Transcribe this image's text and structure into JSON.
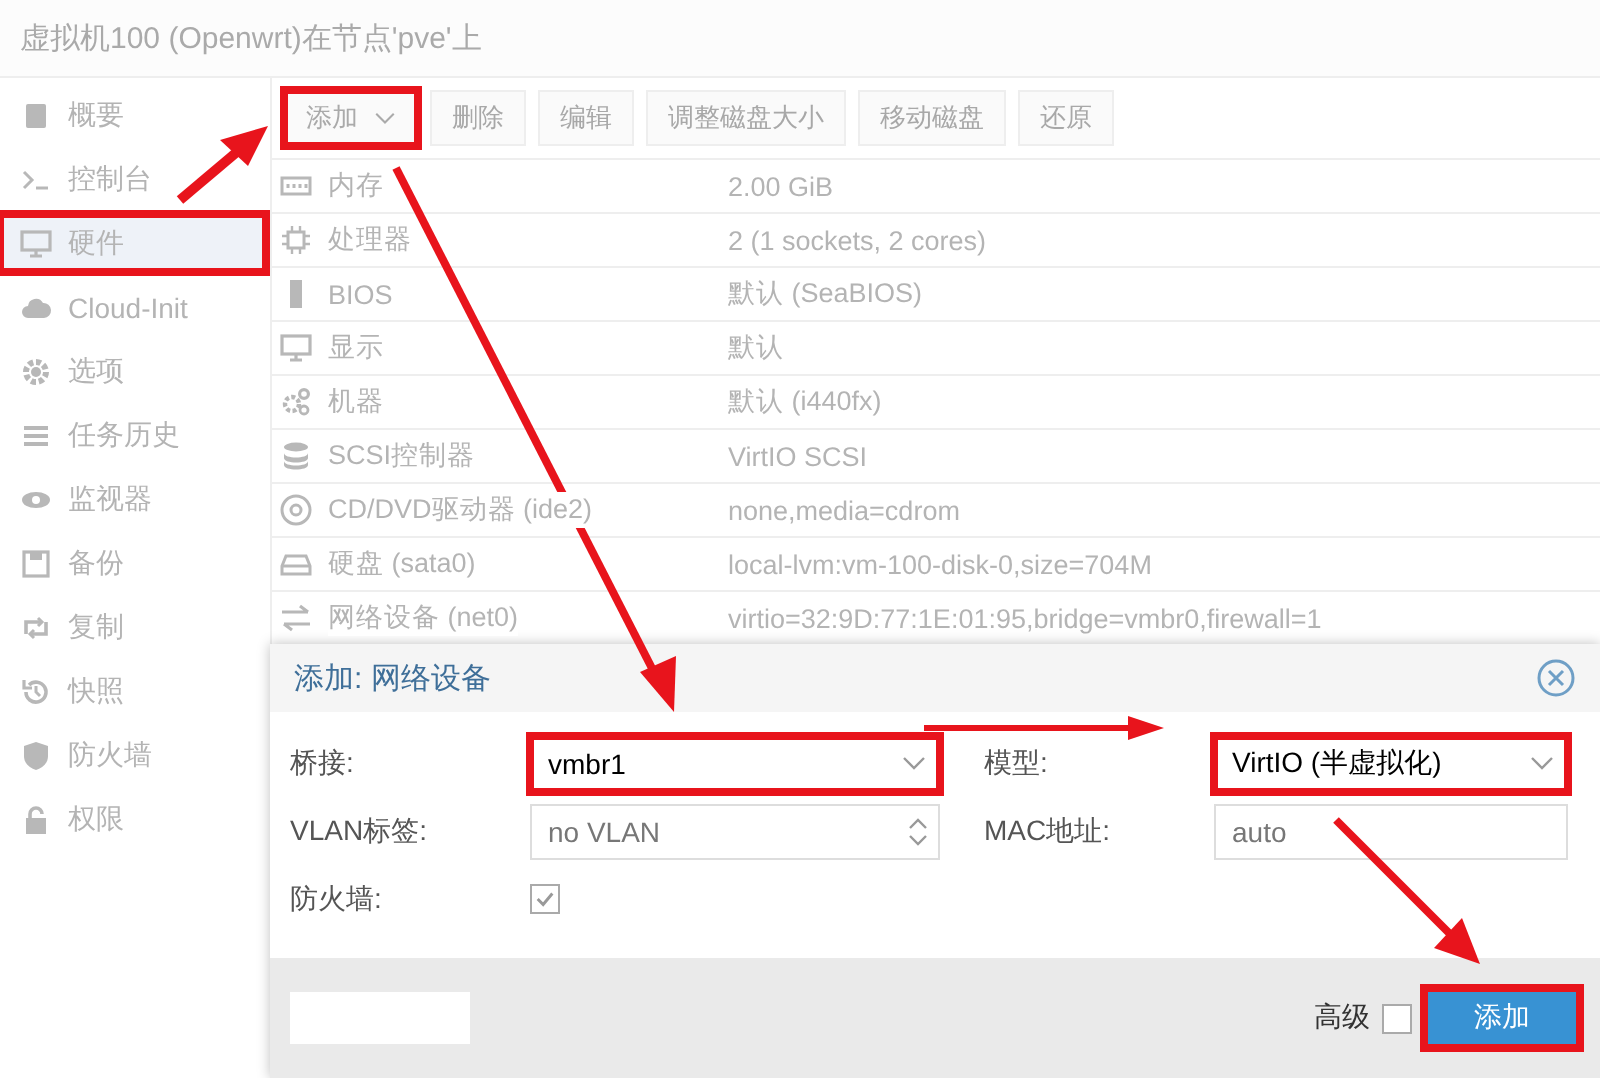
{
  "window": {
    "title": "虚拟机100 (Openwrt)在节点'pve'上"
  },
  "sidebar": {
    "items": [
      {
        "label": "概要",
        "kind": "book",
        "selected": false,
        "highlighted": false
      },
      {
        "label": "控制台",
        "kind": "terminal",
        "selected": false,
        "highlighted": false
      },
      {
        "label": "硬件",
        "kind": "monitor",
        "selected": true,
        "highlighted": true
      },
      {
        "label": "Cloud-Init",
        "kind": "cloud",
        "selected": false,
        "highlighted": false
      },
      {
        "label": "选项",
        "kind": "gear",
        "selected": false,
        "highlighted": false
      },
      {
        "label": "任务历史",
        "kind": "list",
        "selected": false,
        "highlighted": false
      },
      {
        "label": "监视器",
        "kind": "eye",
        "selected": false,
        "highlighted": false
      },
      {
        "label": "备份",
        "kind": "floppy",
        "selected": false,
        "highlighted": false
      },
      {
        "label": "复制",
        "kind": "retweet",
        "selected": false,
        "highlighted": false
      },
      {
        "label": "快照",
        "kind": "history",
        "selected": false,
        "highlighted": false
      },
      {
        "label": "防火墙",
        "kind": "shield",
        "selected": false,
        "highlighted": false
      },
      {
        "label": "权限",
        "kind": "lock",
        "selected": false,
        "highlighted": false
      }
    ]
  },
  "toolbar": {
    "buttons": [
      {
        "label": "添加",
        "dropdown": true,
        "disabled": false,
        "highlighted": true
      },
      {
        "label": "删除",
        "dropdown": false,
        "disabled": true,
        "highlighted": false
      },
      {
        "label": "编辑",
        "dropdown": false,
        "disabled": true,
        "highlighted": false
      },
      {
        "label": "调整磁盘大小",
        "dropdown": false,
        "disabled": true,
        "highlighted": false
      },
      {
        "label": "移动磁盘",
        "dropdown": false,
        "disabled": true,
        "highlighted": false
      },
      {
        "label": "还原",
        "dropdown": false,
        "disabled": true,
        "highlighted": false
      }
    ]
  },
  "table": {
    "rows": [
      {
        "kind": "memory",
        "name": "内存",
        "value": "2.00 GiB"
      },
      {
        "kind": "cpu",
        "name": "处理器",
        "value": "2 (1 sockets, 2 cores)"
      },
      {
        "kind": "chip",
        "name": "BIOS",
        "value": "默认 (SeaBIOS)"
      },
      {
        "kind": "monitor",
        "name": "显示",
        "value": "默认"
      },
      {
        "kind": "gears",
        "name": "机器",
        "value": "默认 (i440fx)"
      },
      {
        "kind": "database",
        "name": "SCSI控制器",
        "value": "VirtIO SCSI"
      },
      {
        "kind": "disc",
        "name": "CD/DVD驱动器 (ide2)",
        "value": "none,media=cdrom"
      },
      {
        "kind": "hdd",
        "name": "硬盘 (sata0)",
        "value": "local-lvm:vm-100-disk-0,size=704M"
      },
      {
        "kind": "exchange",
        "name": "网络设备 (net0)",
        "value": "virtio=32:9D:77:1E:01:95,bridge=vmbr0,firewall=1"
      }
    ]
  },
  "dialog": {
    "title": "添加: 网络设备",
    "fields": [
      {
        "label": "桥接:",
        "kind": "select",
        "value": "vmbr1",
        "highlighted": true
      },
      {
        "label": "模型:",
        "kind": "select",
        "value": "VirtIO (半虚拟化)",
        "highlighted": true
      },
      {
        "label": "VLAN标签:",
        "kind": "spinner",
        "placeholder": "no VLAN"
      },
      {
        "label": "MAC地址:",
        "kind": "text",
        "placeholder": "auto"
      },
      {
        "label": "防火墙:",
        "kind": "checkbox",
        "checked": true
      }
    ],
    "advanced": {
      "label": "高级",
      "checked": false
    },
    "submit": {
      "label": "添加",
      "highlighted": true
    }
  }
}
